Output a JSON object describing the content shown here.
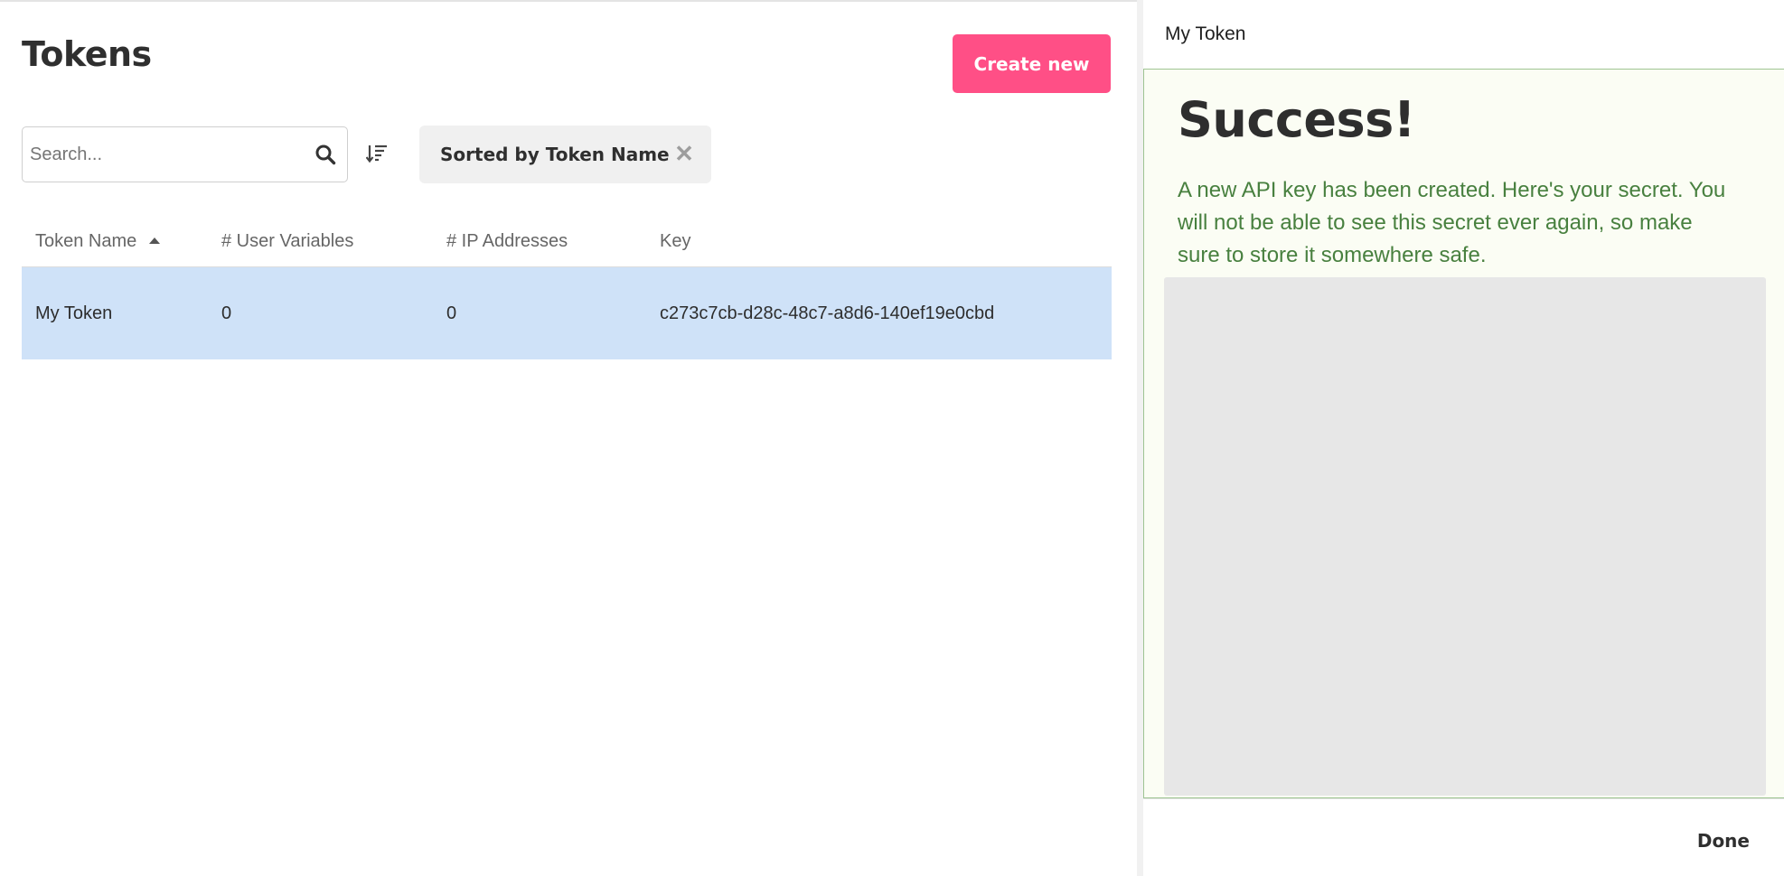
{
  "left_panel": {
    "title": "Tokens",
    "create_button_label": "Create new",
    "search": {
      "placeholder": "Search...",
      "value": ""
    },
    "sort_chip": {
      "label": "Sorted by Token Name",
      "close_glyph": "✕"
    },
    "table": {
      "columns": [
        "Token Name",
        "# User Variables",
        "# IP Addresses",
        "Key"
      ],
      "sorted_column": "Token Name",
      "sort_direction": "ascending",
      "rows": [
        {
          "name": "My Token",
          "user_variables": "0",
          "ip_addresses": "0",
          "key": "c273c7cb-d28c-48c7-a8d6-140ef19e0cbd",
          "selected": true
        }
      ]
    }
  },
  "right_panel": {
    "title": "My Token",
    "success_title": "Success!",
    "success_message": "A new API key has been created. Here's your secret. You will not be able to see this secret ever again, so make sure to store it somewhere safe.",
    "done_label": "Done"
  },
  "icons": [
    "search-icon",
    "sort-icon",
    "close-icon",
    "sort-ascending-icon"
  ],
  "colors": {
    "accent": "#ff4f86",
    "selected_row": "#cfe2f8",
    "success_text": "#48803f",
    "success_border": "#9ec492",
    "success_bg": "#fbfdf4"
  }
}
